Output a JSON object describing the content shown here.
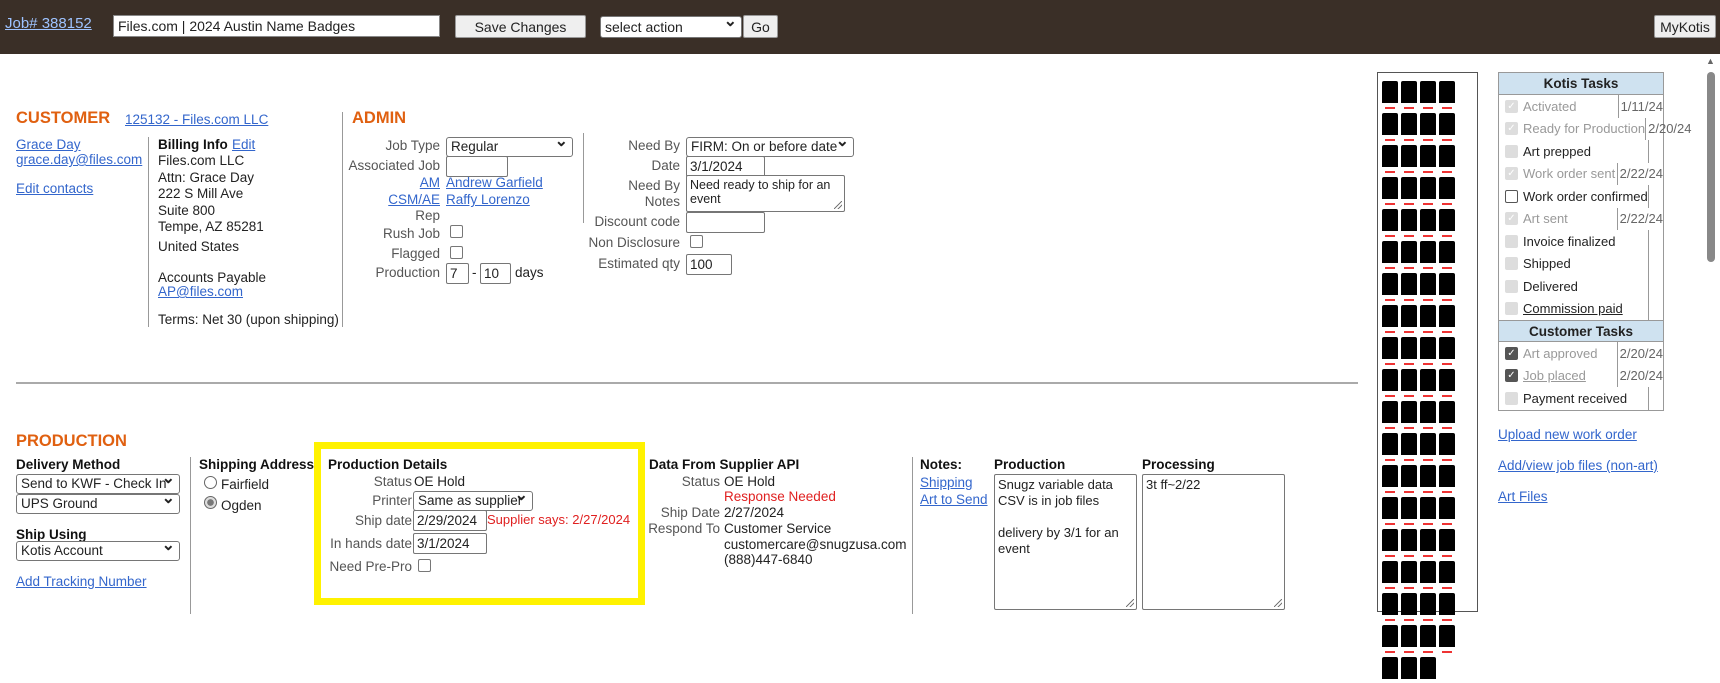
{
  "header": {
    "job_link": "Job# 388152",
    "job_title": "Files.com | 2024 Austin Name Badges",
    "save_label": "Save Changes",
    "action_select": "select action",
    "go_label": "Go",
    "mykotis_label": "MyKotis"
  },
  "customer": {
    "heading": "CUSTOMER",
    "account_link": "125132 - Files.com LLC",
    "contact_name": "Grace Day",
    "contact_email": "grace.day@files.com",
    "edit_contacts": "Edit contacts",
    "billing_label": "Billing Info",
    "billing_edit": "Edit",
    "billing_lines": [
      "Files.com LLC",
      "Attn: Grace Day",
      "222 S Mill Ave",
      "Suite 800",
      "Tempe, AZ 85281"
    ],
    "country": "United States",
    "ap_label": "Accounts Payable",
    "ap_email": "AP@files.com",
    "terms": "Terms: Net 30 (upon shipping)"
  },
  "admin": {
    "heading": "ADMIN",
    "job_type_label": "Job Type",
    "job_type": "Regular",
    "associated_job_label": "Associated Job",
    "associated_job": "",
    "am_label": "AM",
    "am_name": "Andrew Garfield",
    "csm_label": "CSM/AE",
    "csm_name": "Raffy Lorenzo",
    "rep_label": "Rep",
    "rush_label": "Rush Job",
    "flagged_label": "Flagged",
    "production_label": "Production",
    "production_min": "7",
    "production_dash": "-",
    "production_max": "10",
    "production_unit": "days",
    "need_by_label": "Need By",
    "need_by": "FIRM: On or before date",
    "date_label": "Date",
    "date": "3/1/2024",
    "notes_label_1": "Need By",
    "notes_label_2": "Notes",
    "notes": "Need ready to ship for an event",
    "discount_label": "Discount code",
    "discount": "",
    "nda_label": "Non Disclosure",
    "est_qty_label": "Estimated qty",
    "est_qty": "100"
  },
  "production": {
    "heading": "PRODUCTION",
    "delivery_label": "Delivery Method",
    "delivery_method": "Send to KWF - Check In",
    "carrier": "UPS Ground",
    "ship_using_label": "Ship Using",
    "ship_using": "Kotis Account",
    "tracking_link": "Add Tracking Number",
    "shipping_address_label": "Shipping Address",
    "addresses": [
      "Fairfield",
      "Ogden"
    ],
    "details": {
      "heading": "Production Details",
      "status_label": "Status",
      "status": "OE Hold",
      "printer_label": "Printer",
      "printer": "Same as supplier",
      "ship_date_label": "Ship date",
      "ship_date": "2/29/2024",
      "supplier_says": "Supplier says: 2/27/2024",
      "in_hands_label": "In hands date",
      "in_hands": "3/1/2024",
      "prepro_label": "Need Pre-Pro"
    },
    "supplier": {
      "heading": "Data From Supplier API",
      "status_label": "Status",
      "status": "OE Hold",
      "response": "Response Needed",
      "ship_date_label": "Ship Date",
      "ship_date": "2/27/2024",
      "respond_label": "Respond To",
      "respond_name": "Customer Service",
      "respond_email": "customercare@snugzusa.com",
      "respond_phone": "(888)447-6840"
    },
    "notes": {
      "heading": "Notes:",
      "shipping_link": "Shipping",
      "art_link": "Art to Send",
      "production_label": "Production",
      "production_text": "Snugz variable data CSV is in job files\n\ndelivery by 3/1 for an event",
      "processing_label": "Processing",
      "processing_text": "3t ff~2/22"
    }
  },
  "kotis_tasks": {
    "heading": "Kotis Tasks",
    "items": [
      {
        "label": "Activated",
        "date": "1/11/24"
      },
      {
        "label": "Ready for Production",
        "date": "2/20/24"
      },
      {
        "label": "Art prepped",
        "date": ""
      },
      {
        "label": "Work order sent",
        "date": "2/22/24"
      },
      {
        "label": "Work order confirmed",
        "date": ""
      },
      {
        "label": "Art sent",
        "date": "2/22/24"
      },
      {
        "label": "Invoice finalized",
        "date": ""
      },
      {
        "label": "Shipped",
        "date": ""
      },
      {
        "label": "Delivered",
        "date": ""
      },
      {
        "label": "Commission paid",
        "date": ""
      }
    ]
  },
  "customer_tasks": {
    "heading": "Customer Tasks",
    "items": [
      {
        "label": "Art approved",
        "date": "2/20/24"
      },
      {
        "label": "Job placed",
        "date": "2/20/24"
      },
      {
        "label": "Payment received",
        "date": ""
      }
    ]
  },
  "side_links": {
    "upload": "Upload new work order",
    "files": "Add/view job files (non-art)",
    "art": "Art Files"
  }
}
